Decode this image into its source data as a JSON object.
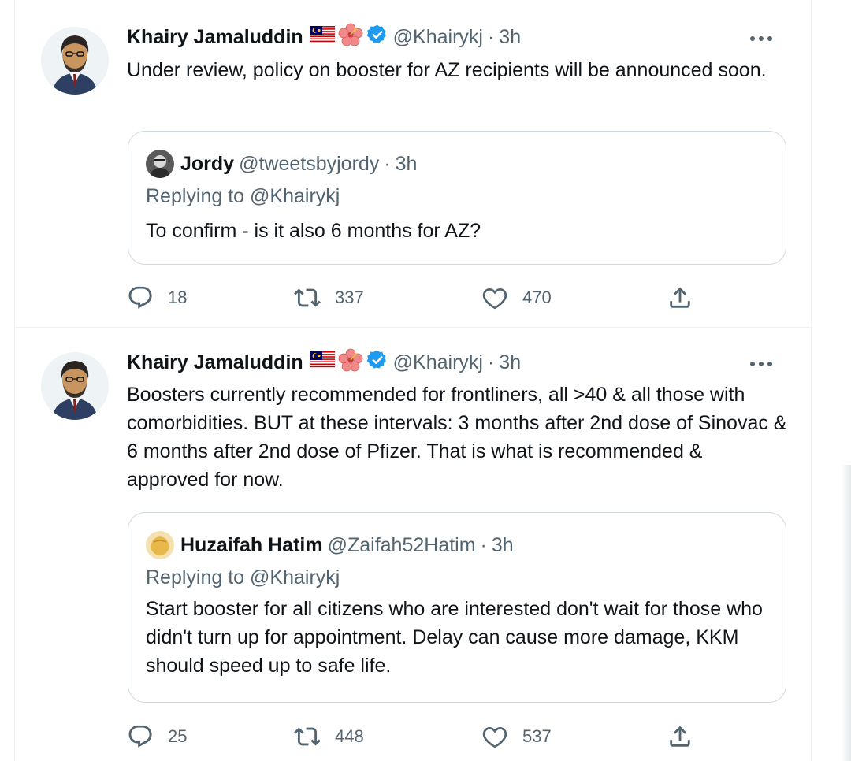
{
  "tweets": [
    {
      "author": {
        "name": "Khairy Jamaluddin",
        "flag_icon": "malaysia-flag-icon",
        "flower_icon": "hibiscus-icon",
        "verified_icon": "verified-badge-icon",
        "handle": "@Khairykj",
        "separator": "·",
        "time": "3h"
      },
      "more_icon": "more-options-icon",
      "text": "Under review, policy on booster for AZ recipients will be announced soon.",
      "quote": {
        "name": "Jordy",
        "handle": "@tweetsbyjordy",
        "separator": "·",
        "time": "3h",
        "replying_prefix": "Replying to",
        "replying_to": "@Khairykj",
        "text": "To confirm - is it also 6 months for AZ?"
      },
      "actions": {
        "reply_count": "18",
        "retweet_count": "337",
        "like_count": "470"
      }
    },
    {
      "author": {
        "name": "Khairy Jamaluddin",
        "flag_icon": "malaysia-flag-icon",
        "flower_icon": "hibiscus-icon",
        "verified_icon": "verified-badge-icon",
        "handle": "@Khairykj",
        "separator": "·",
        "time": "3h"
      },
      "more_icon": "more-options-icon",
      "text": "Boosters currently recommended for frontliners, all >40 & all those with comorbidities. BUT at these intervals: 3 months after 2nd dose of Sinovac & 6 months after 2nd dose of Pfizer. That is what is recommended & approved for now.",
      "quote": {
        "name": "Huzaifah Hatim",
        "handle": "@Zaifah52Hatim",
        "separator": "·",
        "time": "3h",
        "replying_prefix": "Replying to",
        "replying_to": "@Khairykj",
        "text": "Start booster for all citizens who are interested don't wait for those who didn't turn up for appointment. Delay can cause more damage, KKM  should speed up to safe life."
      },
      "actions": {
        "reply_count": "25",
        "retweet_count": "448",
        "like_count": "537"
      }
    }
  ],
  "colors": {
    "text_primary": "#0f1419",
    "text_secondary": "#536471",
    "verified_blue": "#1d9bf0",
    "border": "#cfd9de",
    "divider": "#eff3f4"
  }
}
